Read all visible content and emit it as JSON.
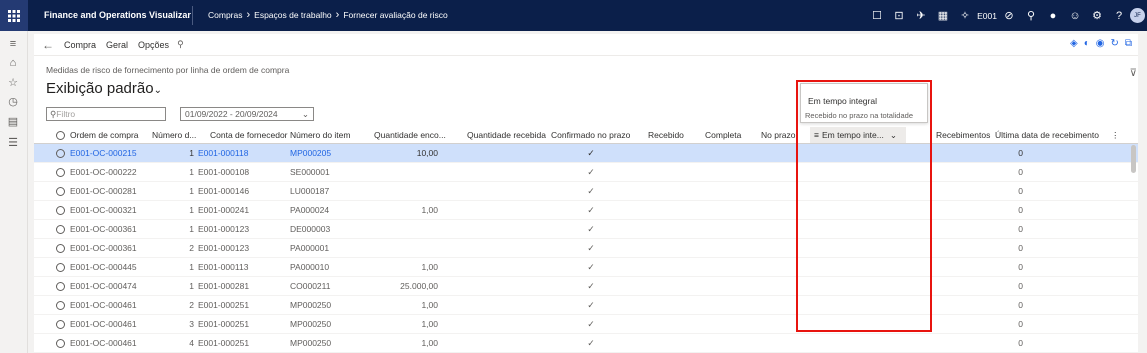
{
  "app": {
    "title": "Finance and Operations Visualizar",
    "breadcrumb": [
      "Compras",
      "Espaços de trabalho",
      "Fornecer avaliação de risco"
    ],
    "company": "E001",
    "avatar_initials": "JF"
  },
  "actionbar": {
    "items": [
      "Compra",
      "Geral",
      "Opções"
    ]
  },
  "page": {
    "subtitle": "Medidas de risco de fornecimento por linha de ordem de compra",
    "view_title": "Exibição padrão",
    "filter_placeholder": "Filtro",
    "date_range": "01/09/2022 - 20/09/2024"
  },
  "columns": [
    "Ordem de compra",
    "Número d...",
    "Conta de fornecedor",
    "Número do item",
    "Quantidade enco...",
    "Quantidade recebida",
    "Confirmado no prazo",
    "Recebido",
    "Completa",
    "No prazo",
    "Em tempo inte...",
    "Recebimentos",
    "Última data de recebimento"
  ],
  "popup": {
    "option1": "Em tempo integral",
    "option2": "Recebido no prazo na totalidade"
  },
  "rows": [
    {
      "po": "E001-OC-000215",
      "line": "1",
      "vendor": "E001-000118",
      "item": "MP000205",
      "qty": "10,00",
      "confirmed": "✓",
      "receipts": "0",
      "selected": true
    },
    {
      "po": "E001-OC-000222",
      "line": "1",
      "vendor": "E001-000108",
      "item": "SE000001",
      "qty": "",
      "confirmed": "✓",
      "receipts": "0"
    },
    {
      "po": "E001-OC-000281",
      "line": "1",
      "vendor": "E001-000146",
      "item": "LU000187",
      "qty": "",
      "confirmed": "✓",
      "receipts": "0"
    },
    {
      "po": "E001-OC-000321",
      "line": "1",
      "vendor": "E001-000241",
      "item": "PA000024",
      "qty": "1,00",
      "confirmed": "✓",
      "receipts": "0"
    },
    {
      "po": "E001-OC-000361",
      "line": "1",
      "vendor": "E001-000123",
      "item": "DE000003",
      "qty": "",
      "confirmed": "✓",
      "receipts": "0"
    },
    {
      "po": "E001-OC-000361",
      "line": "2",
      "vendor": "E001-000123",
      "item": "PA000001",
      "qty": "",
      "confirmed": "✓",
      "receipts": "0"
    },
    {
      "po": "E001-OC-000445",
      "line": "1",
      "vendor": "E001-000113",
      "item": "PA000010",
      "qty": "1,00",
      "confirmed": "✓",
      "receipts": "0"
    },
    {
      "po": "E001-OC-000474",
      "line": "1",
      "vendor": "E001-000281",
      "item": "CO000211",
      "qty": "25.000,00",
      "confirmed": "✓",
      "receipts": "0"
    },
    {
      "po": "E001-OC-000461",
      "line": "2",
      "vendor": "E001-000251",
      "item": "MP000250",
      "qty": "1,00",
      "confirmed": "✓",
      "receipts": "0"
    },
    {
      "po": "E001-OC-000461",
      "line": "3",
      "vendor": "E001-000251",
      "item": "MP000250",
      "qty": "1,00",
      "confirmed": "✓",
      "receipts": "0"
    },
    {
      "po": "E001-OC-000461",
      "line": "4",
      "vendor": "E001-000251",
      "item": "MP000250",
      "qty": "1,00",
      "confirmed": "✓",
      "receipts": "0"
    }
  ],
  "colors": {
    "topbar": "#0b1f4a",
    "accent": "#2266e3",
    "selected_row": "#cfe0fb",
    "highlight": "#e8140f"
  }
}
